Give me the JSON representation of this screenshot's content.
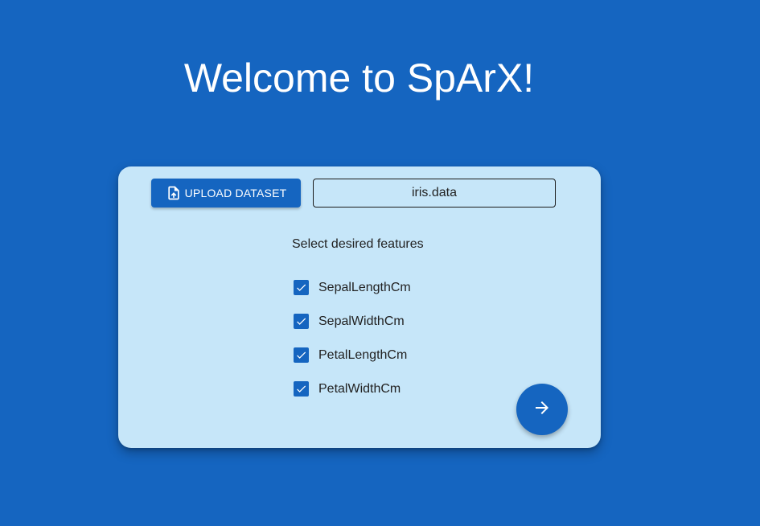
{
  "header": {
    "title": "Welcome to SpArX!"
  },
  "upload": {
    "button_label": "UPLOAD DATASET",
    "icon": "file-upload-icon",
    "file_name": "iris.data"
  },
  "features": {
    "prompt": "Select desired features",
    "items": [
      {
        "label": "SepalLengthCm",
        "checked": true
      },
      {
        "label": "SepalWidthCm",
        "checked": true
      },
      {
        "label": "PetalLengthCm",
        "checked": true
      },
      {
        "label": "PetalWidthCm",
        "checked": true
      }
    ]
  },
  "navigation": {
    "next_icon": "arrow-right-icon"
  },
  "colors": {
    "background": "#1565c0",
    "card": "#c6e6f9",
    "accent": "#1565c0"
  }
}
